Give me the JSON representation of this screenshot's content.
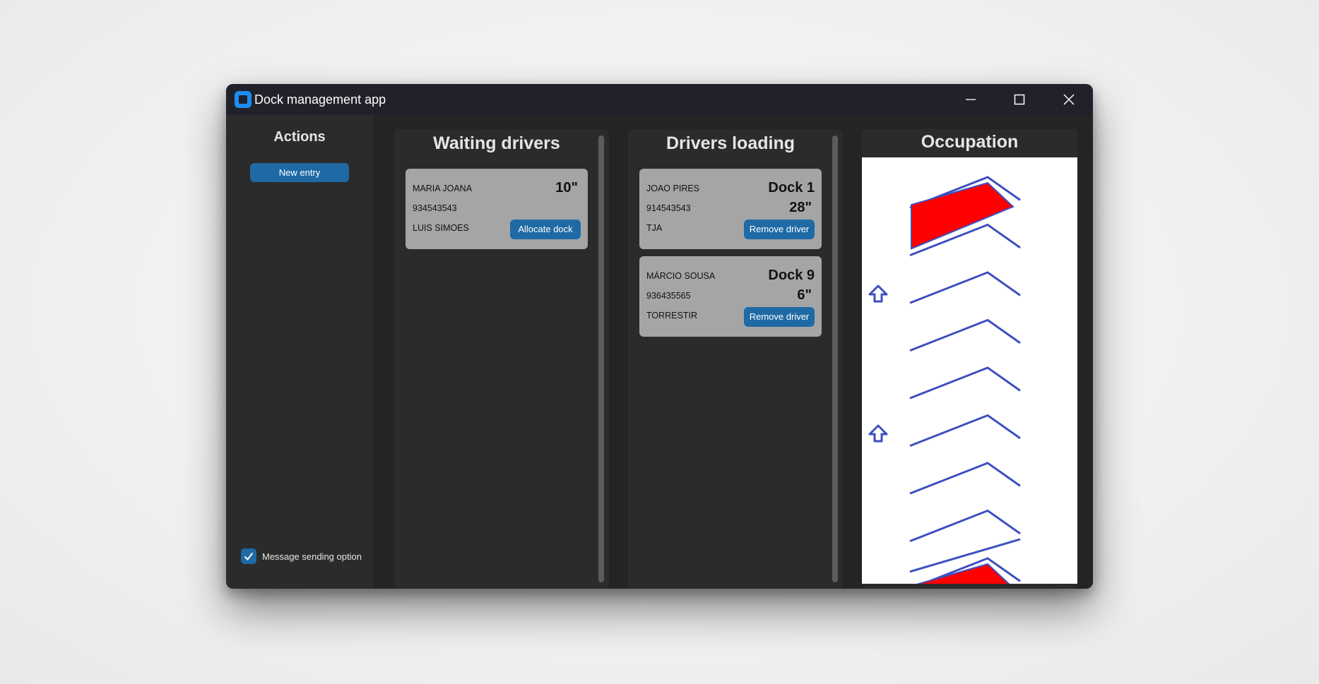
{
  "window": {
    "title": "Dock management app",
    "icons": {
      "app": "app-logo-icon",
      "minimize": "minimize-icon",
      "maximize": "maximize-icon",
      "close": "close-icon"
    }
  },
  "sidebar": {
    "title": "Actions",
    "new_entry_label": "New entry",
    "message_option": {
      "label": "Message sending option",
      "checked": true
    }
  },
  "waiting": {
    "title": "Waiting drivers",
    "cards": [
      {
        "name": "MARIA JOANA",
        "phone": "934543543",
        "company": "LUIS SIMOES",
        "time": "10\"",
        "button": "Allocate dock"
      }
    ]
  },
  "loading": {
    "title": "Drivers loading",
    "cards": [
      {
        "name": "JOAO PIRES",
        "phone": "914543543",
        "company": "TJA",
        "dock": "Dock 1",
        "time": "28\"",
        "button": "Remove driver"
      },
      {
        "name": "MÁRCIO SOUSA",
        "phone": "936435565",
        "company": "TORRESTIR",
        "dock": "Dock 9",
        "time": "6\"",
        "button": "Remove driver"
      }
    ]
  },
  "occupation": {
    "title": "Occupation",
    "dock_count": 9,
    "occupied": [
      1,
      9
    ],
    "colors": {
      "outline": "#3d4fbf",
      "occupied": "#ff0000",
      "background": "#ffffff"
    }
  },
  "colors": {
    "accent": "#1f6aa5",
    "titlebar": "#20212a",
    "card": "#a5a5a5"
  }
}
